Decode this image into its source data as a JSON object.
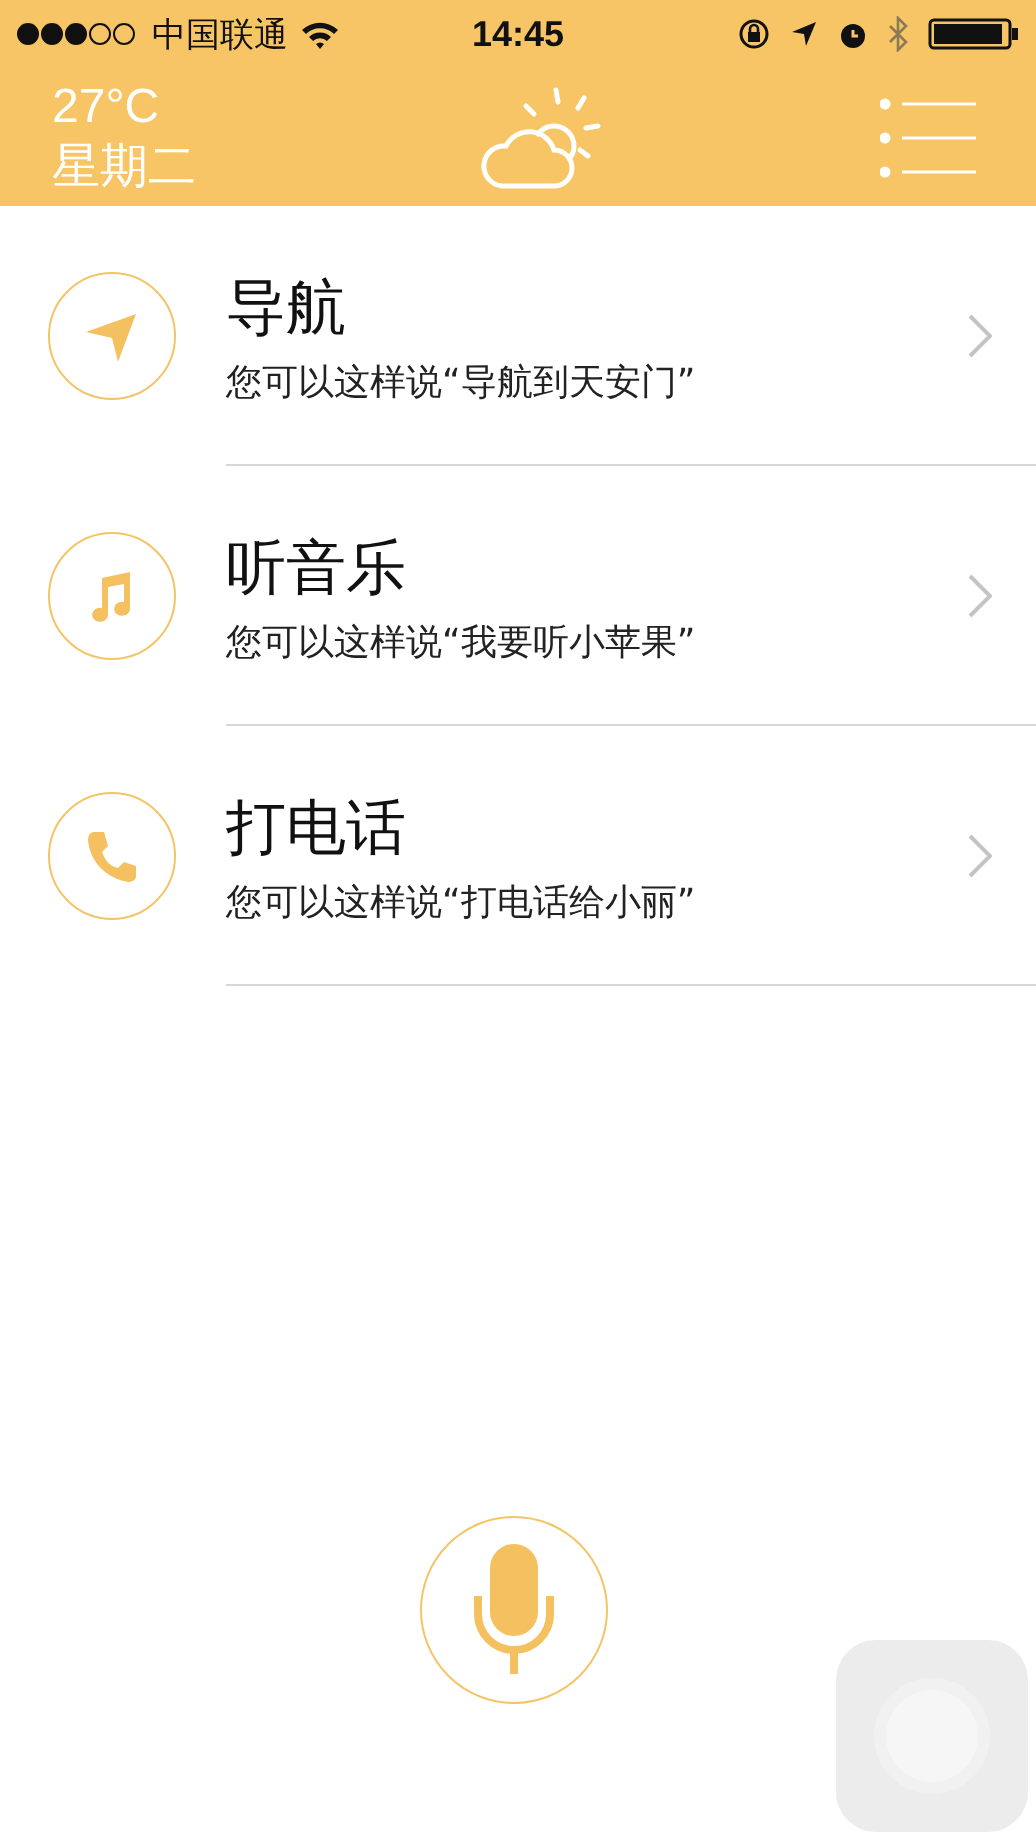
{
  "status_bar": {
    "carrier": "中国联通",
    "time": "14:45"
  },
  "header": {
    "temperature": "27°C",
    "weekday": "星期二"
  },
  "items": [
    {
      "kind": "navigation",
      "title": "导航",
      "hint": "您可以这样说“导航到天安门”"
    },
    {
      "kind": "music",
      "title": "听音乐",
      "hint": "您可以这样说“我要听小苹果”"
    },
    {
      "kind": "phone",
      "title": "打电话",
      "hint": "您可以这样说“打电话给小丽”"
    }
  ]
}
